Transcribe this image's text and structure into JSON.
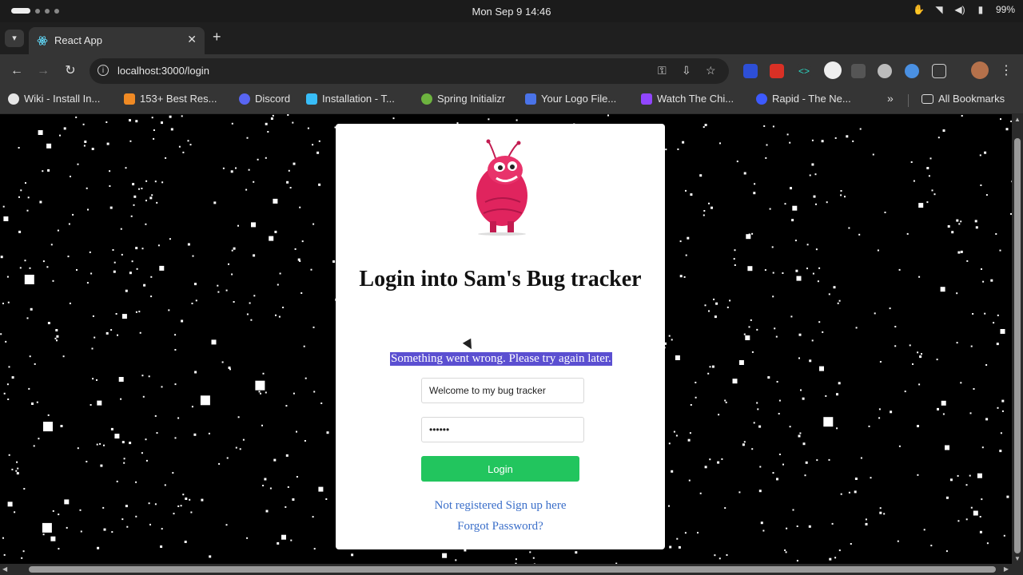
{
  "os": {
    "clock": "Mon Sep 9  14:46",
    "battery": "99%"
  },
  "browser": {
    "tab_title": "React App",
    "url": "localhost:3000/login",
    "bookmarks": [
      {
        "label": "Wiki - Install In...",
        "icon": "github-icon",
        "color": "#e6e6e6"
      },
      {
        "label": "153+ Best Res...",
        "icon": "sxt-icon",
        "color": "#f08a24"
      },
      {
        "label": "Discord",
        "icon": "discord-icon",
        "color": "#5865f2"
      },
      {
        "label": "Installation - T...",
        "icon": "tailwind-icon",
        "color": "#38bdf8"
      },
      {
        "label": "Spring Initializr",
        "icon": "spring-icon",
        "color": "#6db33f"
      },
      {
        "label": "Your Logo File...",
        "icon": "logo-file-icon",
        "color": "#4a73e8"
      },
      {
        "label": "Watch The Chi...",
        "icon": "twitch-icon",
        "color": "#9146ff"
      },
      {
        "label": "Rapid - The Ne...",
        "icon": "rapid-icon",
        "color": "#3d5afe"
      }
    ],
    "all_bookmarks": "All Bookmarks"
  },
  "login": {
    "title": "Login into Sam's Bug tracker",
    "error": "Something went wrong. Please try again later.",
    "username_value": "Welcome to my bug tracker",
    "password_value": "••••••",
    "login_button": "Login",
    "signup_link": "Not registered Sign up here",
    "forgot_link": "Forgot Password?"
  },
  "colors": {
    "accent_green": "#22c55e",
    "link_blue": "#3a6ec9",
    "selection": "#5b4fd1",
    "mascot_pink": "#e0245e"
  }
}
